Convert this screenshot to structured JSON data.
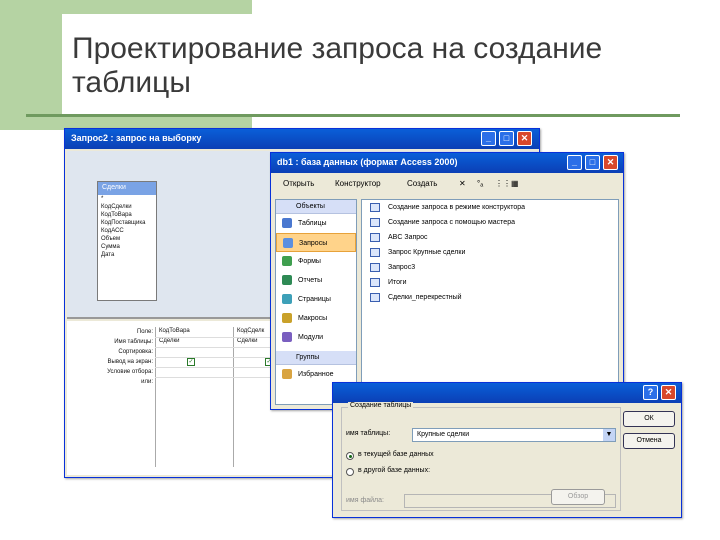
{
  "slide": {
    "title_line1": "Проектирование запроса на создание",
    "title_line2": "таблицы"
  },
  "query_window": {
    "title": "Запрос2 : запрос на выборку",
    "table_box": {
      "title": "Сделки",
      "fields": [
        "*",
        "КодСделки",
        "КодТоВара",
        "КодПоставщика",
        "КодАСС",
        "Объем",
        "Сумма",
        "Дата"
      ]
    },
    "grid_labels": [
      "Поле:",
      "Имя таблицы:",
      "Сортировка:",
      "Вывод на экран:",
      "Условие отбора:",
      "или:"
    ],
    "grid_columns": [
      {
        "field": "КодТоВара",
        "table": "Сделки"
      },
      {
        "field": "КодСделк",
        "table": "Сделки"
      }
    ]
  },
  "db_window": {
    "title": "db1 : база данных (формат Access 2000)",
    "toolbar": [
      "Открыть",
      "Конструктор",
      "Создать",
      "✕",
      "°ₐ",
      "⋮⋮",
      "▦"
    ],
    "objects_header": "Объекты",
    "objects": [
      {
        "label": "Таблицы",
        "icon": "table-icon",
        "selected": false
      },
      {
        "label": "Запросы",
        "icon": "query-icon",
        "selected": true
      },
      {
        "label": "Формы",
        "icon": "form-icon",
        "selected": false
      },
      {
        "label": "Отчеты",
        "icon": "report-icon",
        "selected": false
      },
      {
        "label": "Страницы",
        "icon": "page-icon",
        "selected": false
      },
      {
        "label": "Макросы",
        "icon": "macro-icon",
        "selected": false
      },
      {
        "label": "Модули",
        "icon": "module-icon",
        "selected": false
      }
    ],
    "groups_header": "Группы",
    "groups": [
      {
        "label": "Избранное",
        "icon": "favorites-icon"
      }
    ],
    "queries": [
      "Создание запроса в режиме конструктора",
      "Создание запроса с помощью мастера",
      "ABC Запрос",
      "Запрос Крупные сделки",
      "Запрос3",
      "Итоги",
      "Сделки_перекрестный"
    ]
  },
  "dialog": {
    "group_label": "Создание таблицы",
    "name_label": "имя таблицы:",
    "name_value": "Крупные сделки",
    "radio_current": "в текущей базе данных",
    "radio_other": "в другой базе данных:",
    "filename_label": "имя файла:",
    "ok": "ОК",
    "cancel": "Отмена",
    "browse": "Обзор",
    "help": "?",
    "close": "✕"
  },
  "colors": {
    "accent": "#b5d3a3",
    "rule": "#6f9a5f",
    "xp_blue": "#0b3fb5"
  }
}
